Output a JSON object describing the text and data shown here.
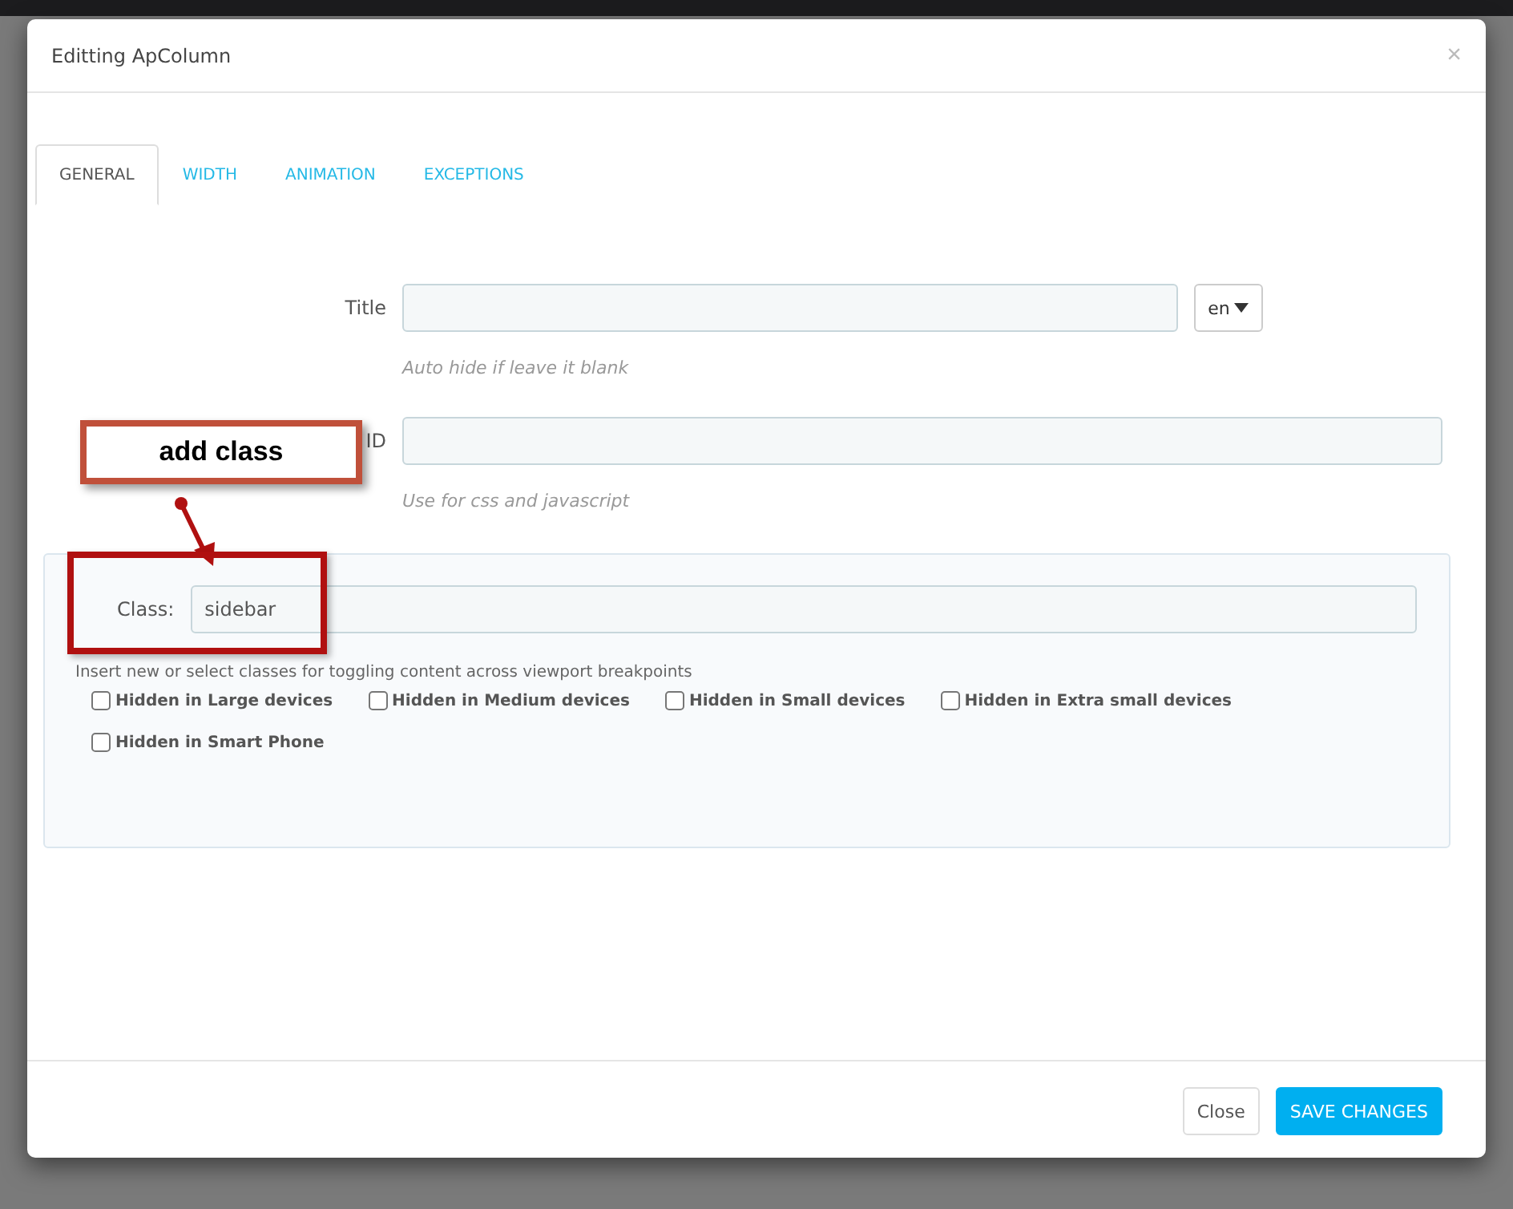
{
  "dialog": {
    "title": "Editting ApColumn",
    "close": "×"
  },
  "tabs": [
    {
      "label": "GENERAL",
      "selected": true
    },
    {
      "label": "WIDTH",
      "selected": false
    },
    {
      "label": "ANIMATION",
      "selected": false
    },
    {
      "label": "EXCEPTIONS",
      "selected": false
    }
  ],
  "title_field": {
    "label": "Title",
    "language": "en",
    "hint": "Auto hide if leave it blank"
  },
  "id_field": {
    "label": "ID",
    "hint": "Use for css and javascript"
  },
  "class_field": {
    "label": "Class:",
    "value": "sidebar",
    "help": "Insert new or select classes for toggling content across viewport breakpoints"
  },
  "options": [
    {
      "label": "Hidden in Large devices",
      "checked": false
    },
    {
      "label": "Hidden in Medium devices",
      "checked": false
    },
    {
      "label": "Hidden in Small devices",
      "checked": false
    },
    {
      "label": "Hidden in Extra small devices",
      "checked": false
    },
    {
      "label": "Hidden in Smart Phone",
      "checked": false
    }
  ],
  "buttons": [
    {
      "label": "Close",
      "kind": "default"
    },
    {
      "label": "SAVE CHANGES",
      "kind": "primary"
    }
  ],
  "annotation": {
    "label": "add class"
  }
}
